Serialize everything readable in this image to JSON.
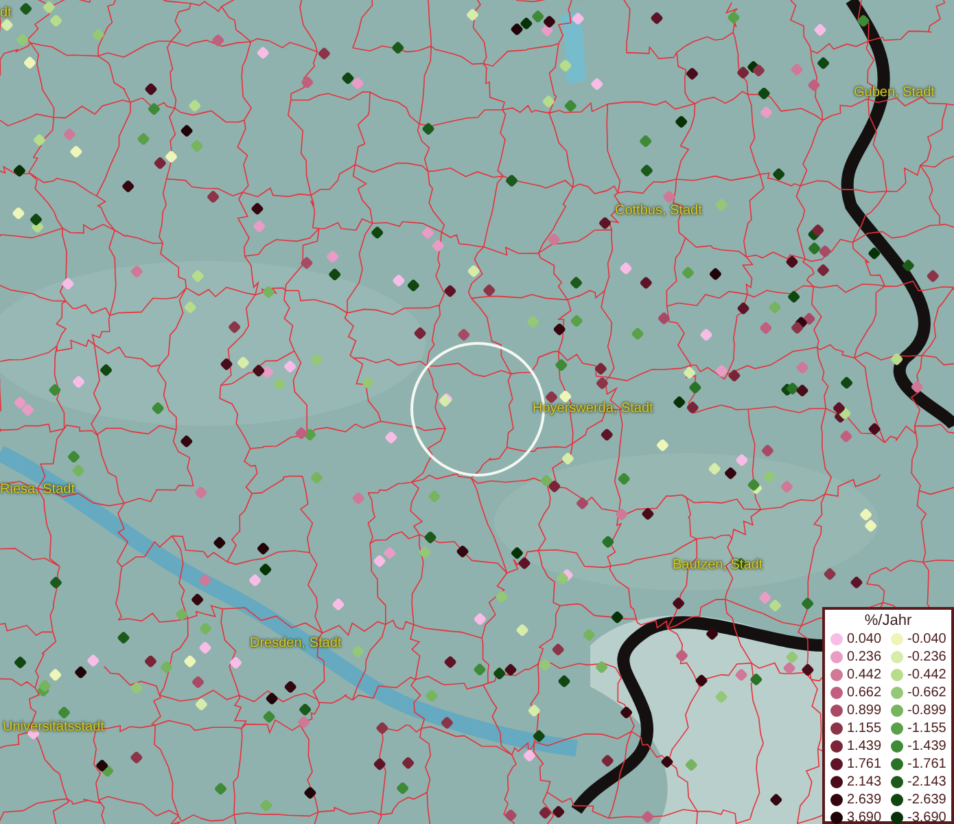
{
  "map": {
    "labels": [
      {
        "text": "dt"
      },
      {
        "text": "Guben, Stadt"
      },
      {
        "text": "Cottbus, Stadt"
      },
      {
        "text": "Hoyerswerda, Stadt"
      },
      {
        "text": "Riesa, Stadt"
      },
      {
        "text": "Bautzen, Stadt"
      },
      {
        "text": "Dresden, Stadt"
      },
      {
        "text": "Universitätsstadt"
      }
    ]
  },
  "legend": {
    "title": "%/Jahr",
    "positive": [
      {
        "label": "0.040",
        "color": "#f7bde6"
      },
      {
        "label": "0.236",
        "color": "#e89cc6"
      },
      {
        "label": "0.442",
        "color": "#d07898"
      },
      {
        "label": "0.662",
        "color": "#c0607e"
      },
      {
        "label": "0.899",
        "color": "#a84a66"
      },
      {
        "label": "1.155",
        "color": "#8c3448"
      },
      {
        "label": "1.439",
        "color": "#7a2438"
      },
      {
        "label": "1.761",
        "color": "#5e1426"
      },
      {
        "label": "2.143",
        "color": "#4a0c1a"
      },
      {
        "label": "2.639",
        "color": "#340610"
      },
      {
        "label": "3.690",
        "color": "#200408"
      }
    ],
    "negative": [
      {
        "label": "-0.040",
        "color": "#eef5b8"
      },
      {
        "label": "-0.236",
        "color": "#d6eca8"
      },
      {
        "label": "-0.442",
        "color": "#b6dc8c"
      },
      {
        "label": "-0.662",
        "color": "#94c876"
      },
      {
        "label": "-0.899",
        "color": "#76b45e"
      },
      {
        "label": "-1.155",
        "color": "#5aa048"
      },
      {
        "label": "-1.439",
        "color": "#3e8a36"
      },
      {
        "label": "-1.761",
        "color": "#2a7228"
      },
      {
        "label": "-2.143",
        "color": "#1c5a1c"
      },
      {
        "label": "-2.639",
        "color": "#104610"
      },
      {
        "label": "-3.690",
        "color": "#063206"
      }
    ]
  }
}
